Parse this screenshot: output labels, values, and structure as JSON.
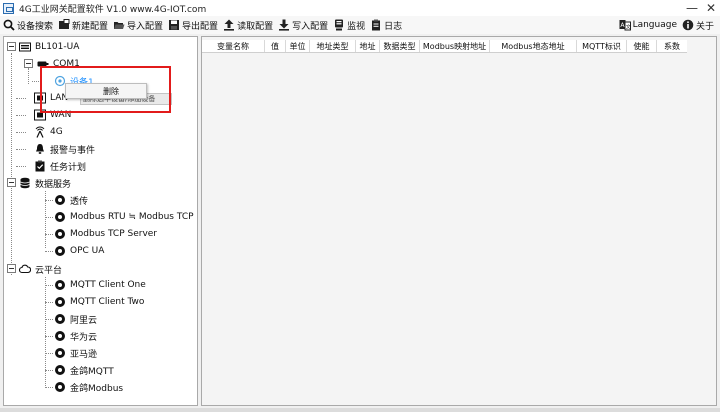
{
  "window": {
    "title": "4G工业网关配置软件 V1.0 www.4G-IOT.com",
    "minimize_glyph": "—",
    "close_glyph": "✕"
  },
  "toolbar": {
    "items": [
      {
        "label": "设备搜索",
        "icon": "search-icon"
      },
      {
        "label": "新建配置",
        "icon": "new-config-icon"
      },
      {
        "label": "导入配置",
        "icon": "folder-open-icon"
      },
      {
        "label": "导出配置",
        "icon": "save-icon"
      },
      {
        "label": "读取配置",
        "icon": "upload-arrow-icon"
      },
      {
        "label": "写入配置",
        "icon": "download-arrow-icon"
      },
      {
        "label": "监视",
        "icon": "monitor-icon"
      },
      {
        "label": "日志",
        "icon": "log-icon"
      }
    ],
    "language_label": "Language",
    "about_label": "关于"
  },
  "tree": {
    "root": "BL101-UA",
    "com1": "COM1",
    "device1": "设备1",
    "lan": "LAN",
    "wan": "WAN",
    "g4": "4G",
    "alarm": "报警与事件",
    "task": "任务计划",
    "data_service": "数据服务",
    "transparent": "透传",
    "rtu_tcp": "Modbus RTU ≒ Modbus TCP",
    "tcp_server": "Modbus TCP Server",
    "opc_ua": "OPC UA",
    "cloud": "云平台",
    "mqtt_one": "MQTT Client One",
    "mqtt_two": "MQTT Client Two",
    "aliyun": "阿里云",
    "huawei": "华为云",
    "amazon": "亚马逊",
    "jinge_mqtt": "金鸽MQTT",
    "jinge_modbus": "金鸽Modbus"
  },
  "context_menu": {
    "delete_label": "删除",
    "ghost_text": "删除选中设备/添加设备"
  },
  "table": {
    "columns": [
      "变量名称",
      "值",
      "单位",
      "地址类型",
      "地址",
      "数据类型",
      "Modbus映射地址",
      "Modbus地态地址",
      "MQTT标识",
      "使能",
      "系数"
    ],
    "rows": []
  },
  "colors": {
    "highlight_border": "#e21b1b",
    "selected_text": "#1e90ff",
    "icon_blue": "#2b6cb0"
  }
}
